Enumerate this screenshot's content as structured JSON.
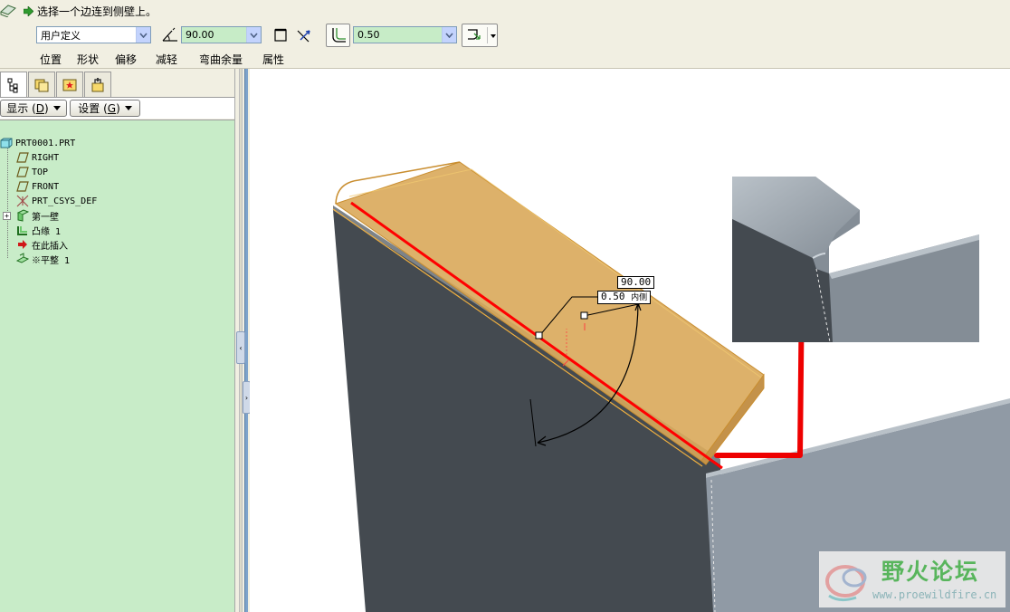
{
  "dashboard": {
    "prompt": "选择一个边连到侧壁上。",
    "shape_type": "用户定义",
    "angle_value": "90.00",
    "radius_value": "0.50",
    "tabs": [
      "位置",
      "形状",
      "偏移",
      "减轻",
      "弯曲余量",
      "属性"
    ]
  },
  "model_tree": {
    "display_menu": "显示",
    "display_key": "D",
    "settings_menu": "设置",
    "settings_key": "G",
    "items": [
      {
        "label": "PRT0001.PRT",
        "icon": "part-icon"
      },
      {
        "label": "RIGHT",
        "icon": "datum-plane-icon"
      },
      {
        "label": "TOP",
        "icon": "datum-plane-icon"
      },
      {
        "label": "FRONT",
        "icon": "datum-plane-icon"
      },
      {
        "label": "PRT_CSYS_DEF",
        "icon": "csys-icon"
      },
      {
        "label": "第一壁",
        "icon": "first-wall-icon"
      },
      {
        "label": "凸缘 1",
        "icon": "flange-icon"
      },
      {
        "label": "在此插入",
        "icon": "insert-arrow-icon"
      },
      {
        "label": "※平整 1",
        "icon": "flat-wall-icon"
      }
    ]
  },
  "graphics": {
    "dim_angle": "90.00",
    "dim_radius": "0.50",
    "dim_radius_suffix": "内侧"
  },
  "watermark": {
    "title": "野火论坛",
    "url": "www.proewildfire.cn"
  },
  "colors": {
    "dashboard_bg": "#f1efe2",
    "tree_bg": "#c8ecc8",
    "input_green": "#c7ecc7",
    "wall_dark": "#444a50",
    "wall_gray": "#909aa5",
    "flange_orange": "#d9a85a",
    "highlight_red": "#ff0000"
  }
}
